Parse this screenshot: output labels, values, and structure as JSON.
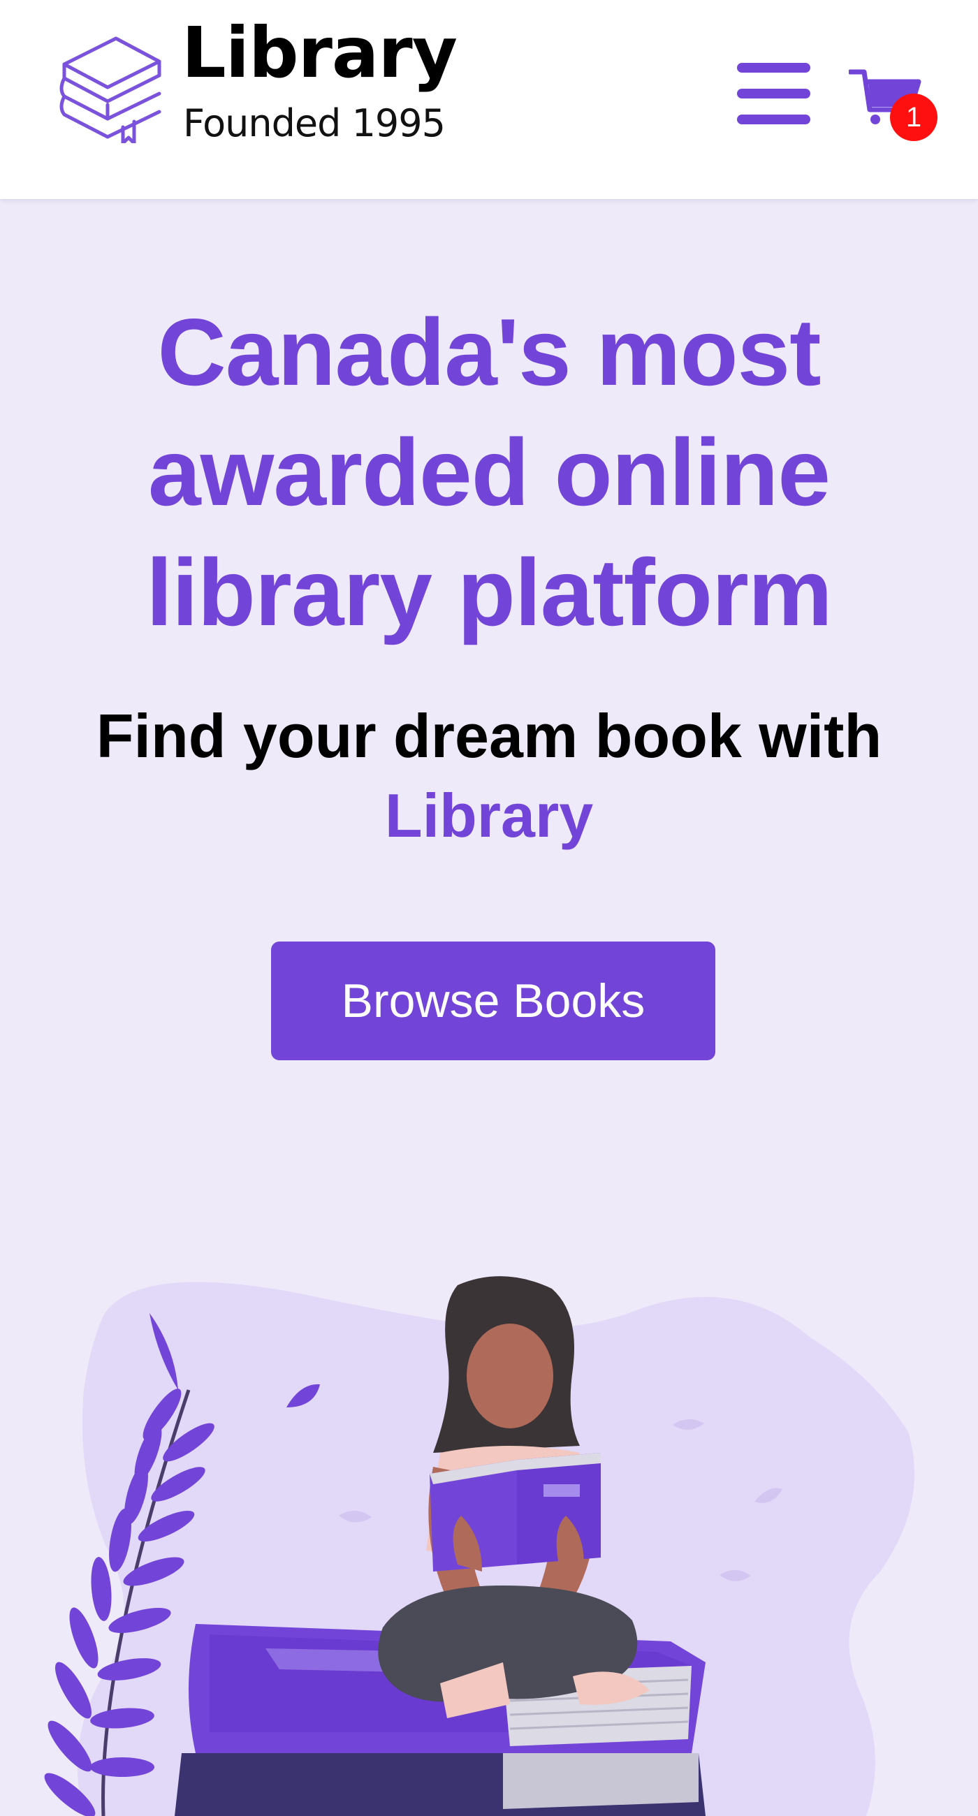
{
  "header": {
    "brand_name": "Library",
    "brand_tagline": "Founded 1995",
    "cart_count": "1",
    "logo_icon": "stacked-books-icon",
    "menu_icon": "hamburger-icon",
    "cart_icon": "shopping-cart-icon"
  },
  "hero": {
    "title": "Canada's most awarded online library platform",
    "subtitle": "Find your dream book with",
    "subtitle_brand": "Library",
    "cta_label": "Browse Books"
  },
  "colors": {
    "accent": "#7245d8",
    "page_background": "#efeaf9",
    "badge": "#ff1010",
    "header_background": "#ffffff"
  }
}
